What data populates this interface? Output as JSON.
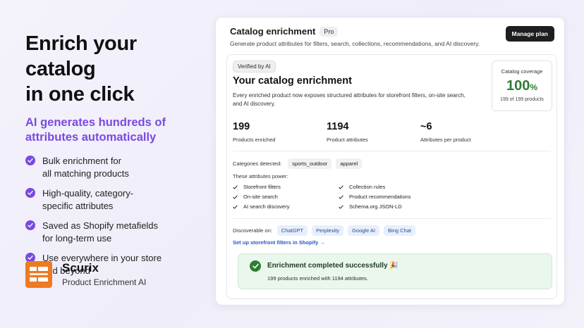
{
  "hero": {
    "title_line1": "Enrich your catalog",
    "title_line2": "in one click",
    "subtitle_line1": "AI generates hundreds of",
    "subtitle_line2": "attributes automatically",
    "features": [
      {
        "line1": "Bulk enrichment for",
        "line2": "all matching products"
      },
      {
        "line1": "High-quality, category-",
        "line2": "specific attributes"
      },
      {
        "line1": "Saved as Shopify metafields",
        "line2": "for long-term use"
      },
      {
        "line1": "Use everywhere in your store",
        "line2": "and beyond"
      }
    ]
  },
  "brand": {
    "name": "Scurix",
    "tagline": "Product Enrichment AI",
    "color": "#ee7a22"
  },
  "card": {
    "title": "Catalog enrichment",
    "badge": "Pro",
    "description": "Generate product attributes for filters, search, collections, recommendations, and AI discovery.",
    "manage_button": "Manage plan",
    "verified_badge": "Verified by AI",
    "inner_title": "Your catalog enrichment",
    "inner_description": "Every enriched product now exposes structured attributes for storefront filters, on-site search, and AI discovery.",
    "coverage": {
      "label": "Catalog coverage",
      "value": "100",
      "unit": "%",
      "sub": "199 of 199 products"
    },
    "stats": [
      {
        "value": "199",
        "label": "Products enriched"
      },
      {
        "value": "1194",
        "label": "Product attributes"
      },
      {
        "value": "~6",
        "label": "Attributes per product"
      }
    ],
    "categories_label": "Categories detected:",
    "categories": [
      "sports_outdoor",
      "apparel"
    ],
    "powers_label": "These attributes power:",
    "powers": [
      "Storefront filters",
      "Collection rules",
      "On-site search",
      "Product recommendations",
      "AI search discovery",
      "Schema.org JSON-LD"
    ],
    "discoverable_label": "Discoverable on:",
    "discoverable": [
      "ChatGPT",
      "Perplexity",
      "Google AI",
      "Bing Chat"
    ],
    "setup_link": "Set up storefront filters in Shopify →",
    "success": {
      "title": "Enrichment completed successfully 🎉",
      "description": "199 products enriched with 1194 attributes."
    }
  },
  "colors": {
    "accent": "#7a4ae0",
    "success": "#2e7d32",
    "link": "#2957c5"
  }
}
